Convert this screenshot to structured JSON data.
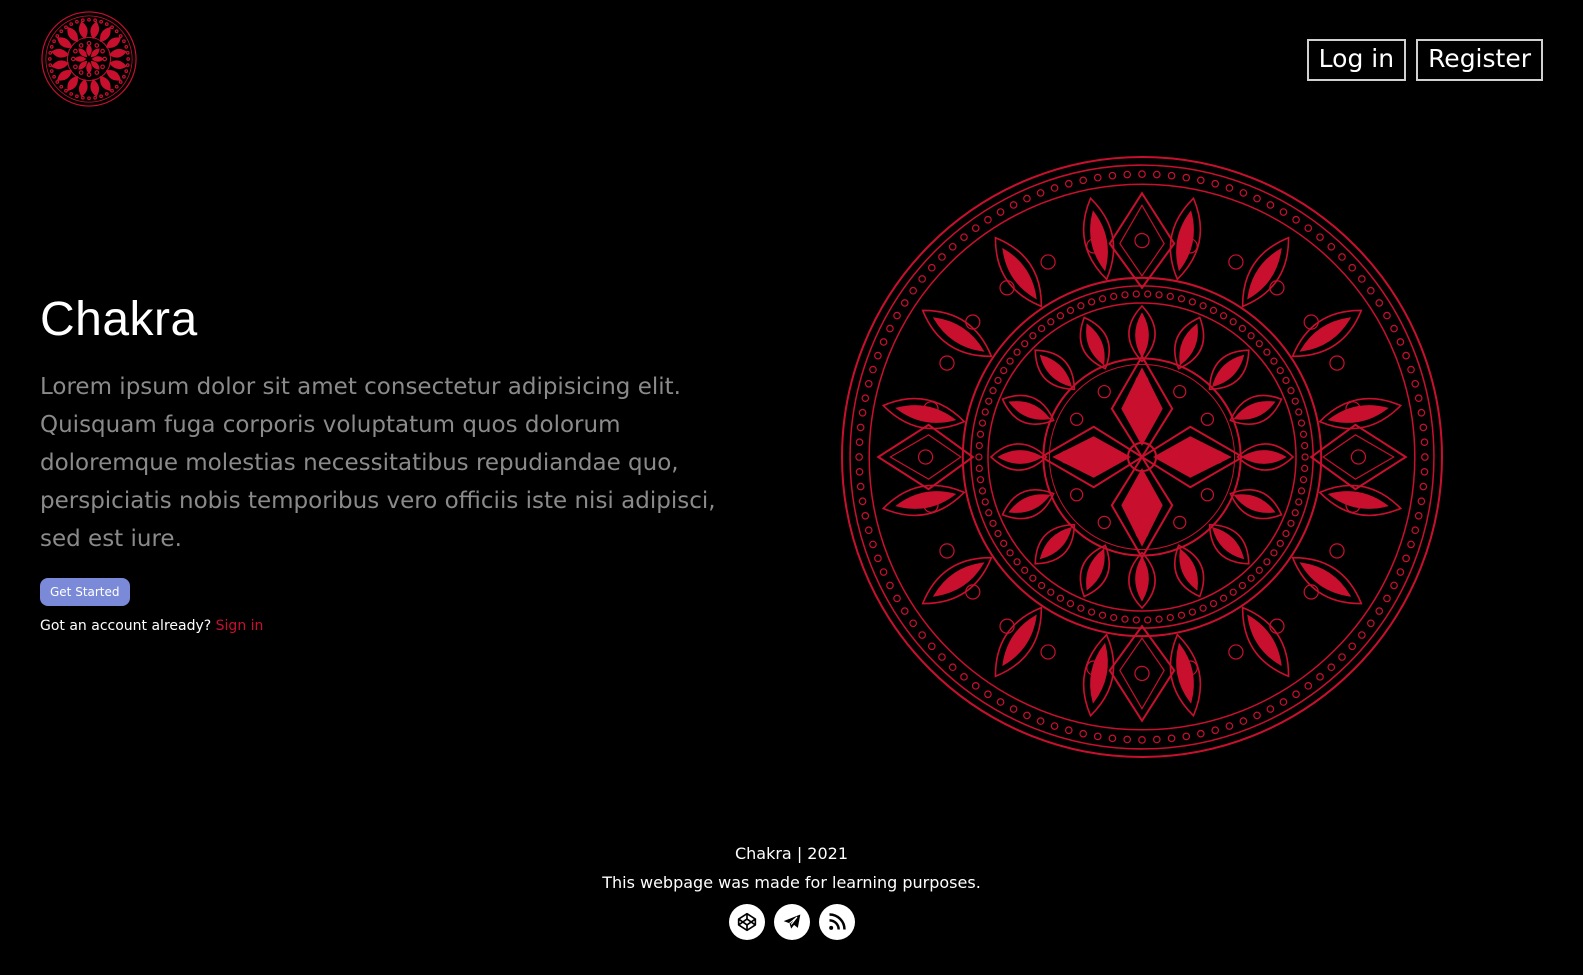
{
  "header": {
    "logo_icon": "mandala-logo-icon",
    "login_label": "Log in",
    "register_label": "Register"
  },
  "hero": {
    "title": "Chakra",
    "description": "Lorem ipsum dolor sit amet consectetur adipisicing elit. Quisquam fuga corporis voluptatum quos dolorum doloremque molestias necessitatibus repudiandae quo, perspiciatis nobis temporibus vero officiis iste nisi adipisci, sed est iure.",
    "cta_label": "Get Started",
    "account_prompt": "Got an account already?",
    "signin_label": "Sign in",
    "image_icon": "mandala-illustration"
  },
  "footer": {
    "line1": "Chakra | 2021",
    "line2": "This webpage was made for learning purposes.",
    "socials": [
      {
        "icon": "codepen-icon"
      },
      {
        "icon": "telegram-icon"
      },
      {
        "icon": "rss-icon"
      }
    ]
  },
  "colors": {
    "background": "#000000",
    "accent_red": "#c8102e",
    "cta_blue": "#7b8ad8",
    "muted_text": "#8a8a8a"
  }
}
